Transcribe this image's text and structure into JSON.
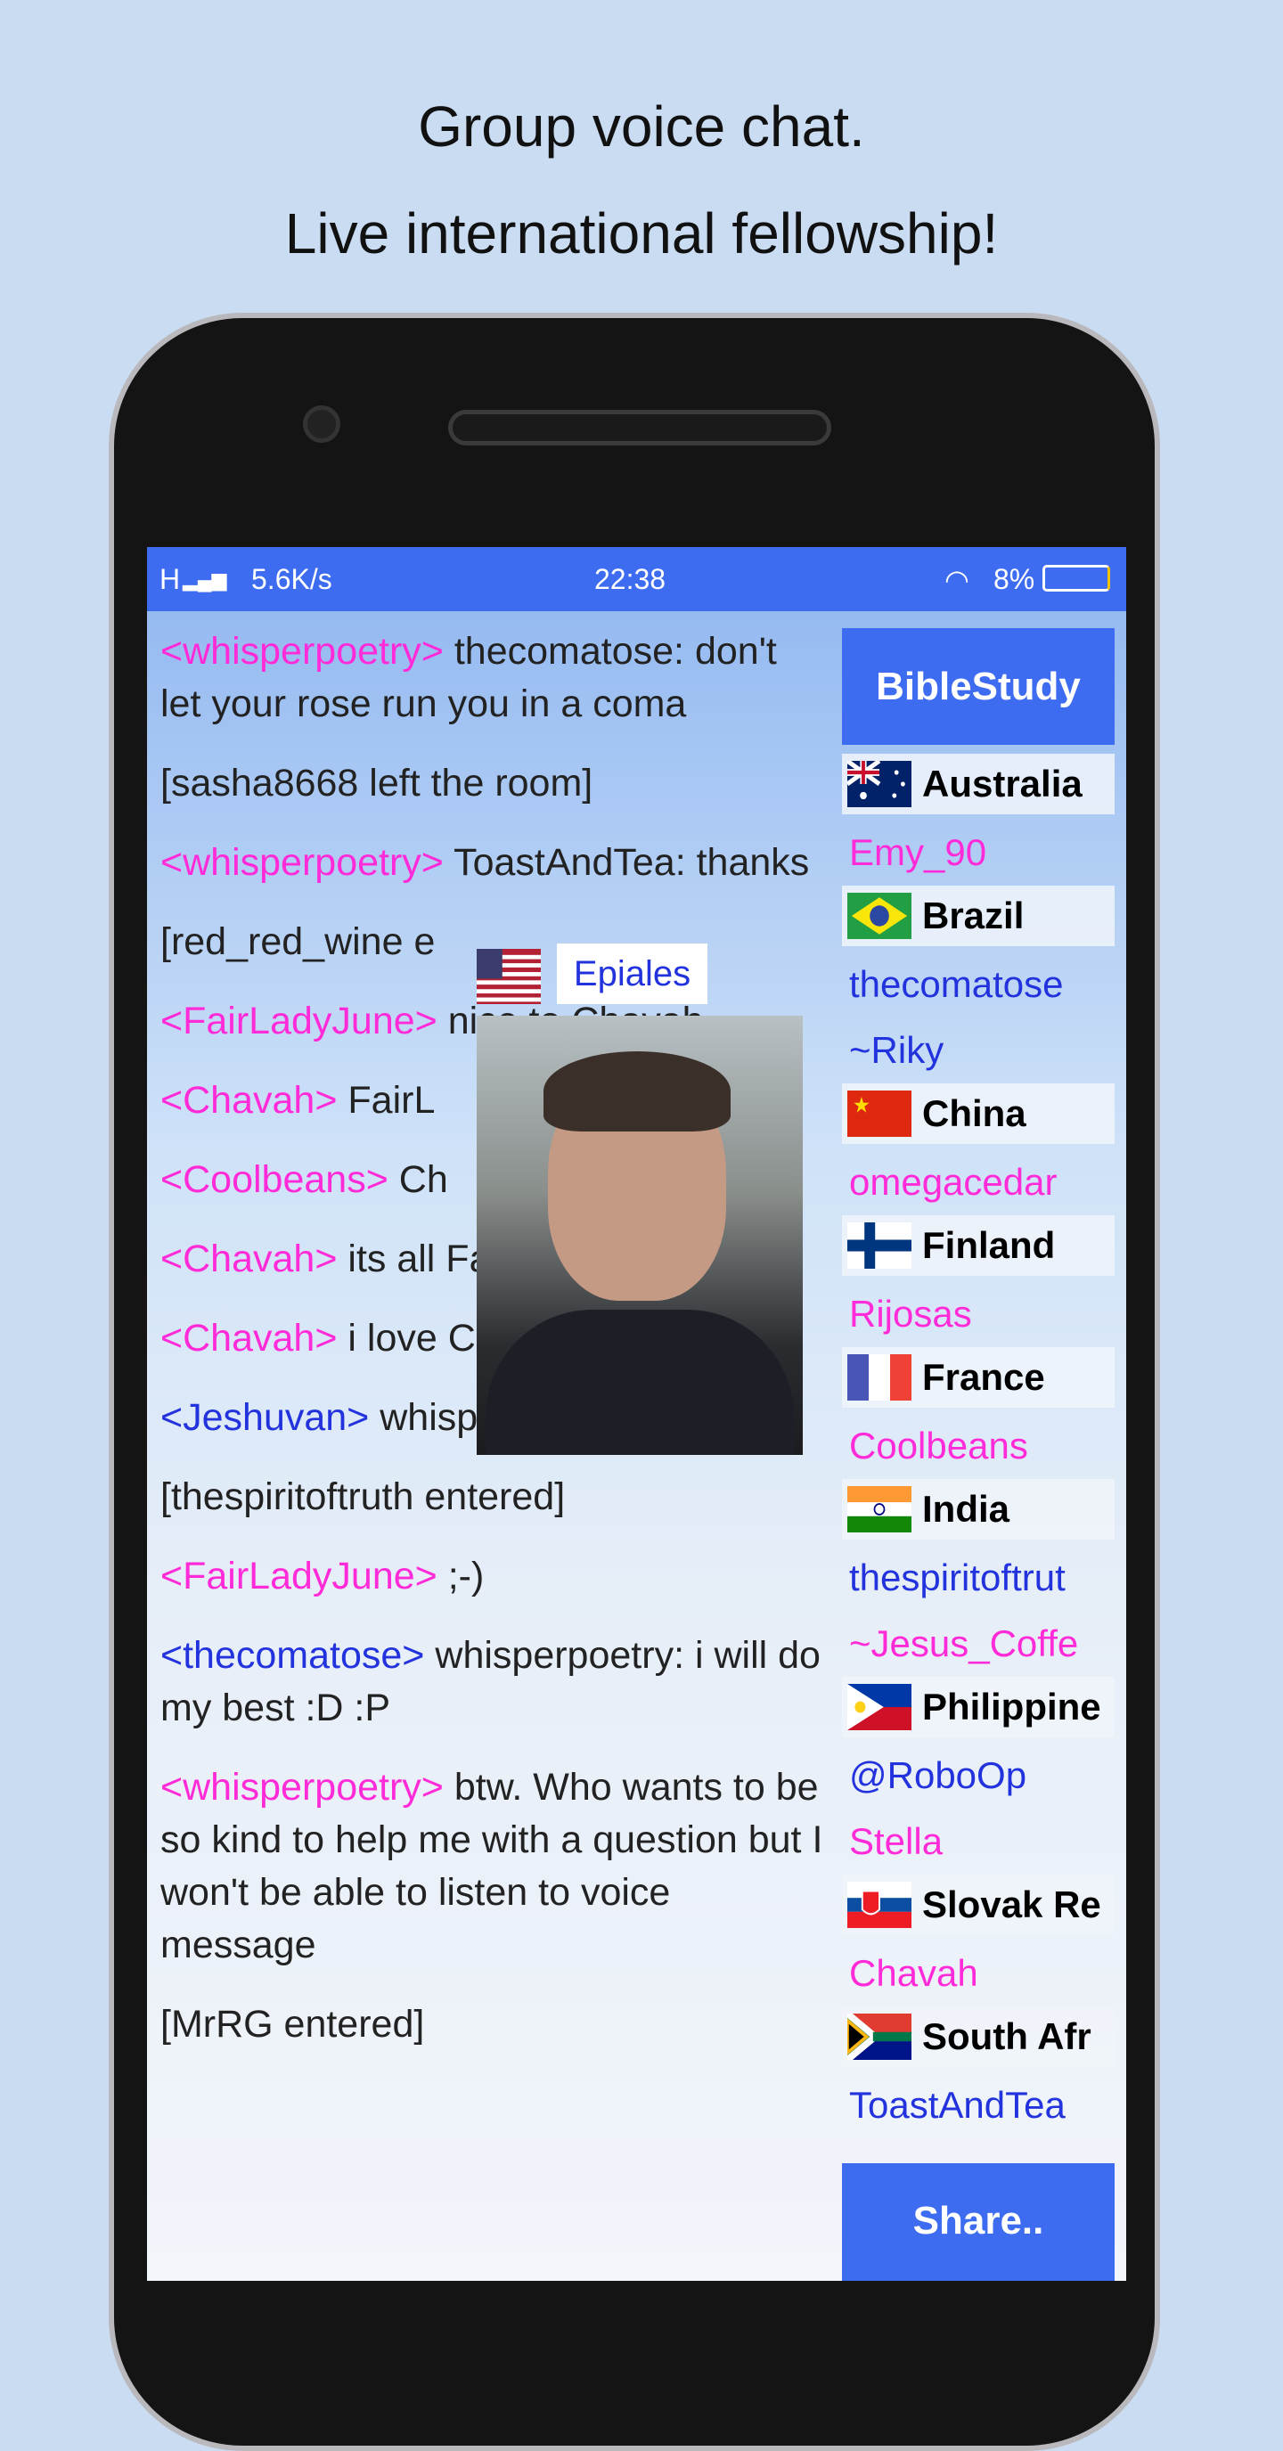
{
  "headline": [
    "Group voice chat.",
    "Live international fellowship!"
  ],
  "status": {
    "network": "H",
    "speed": "5.6K/s",
    "time": "22:38",
    "battery": "8%"
  },
  "chat": [
    {
      "nick": "<whisperpoetry>",
      "color": "pink",
      "text": " thecomatose: don't let your rose run you in a coma"
    },
    {
      "nick": "",
      "text": "[sasha8668 left the room]"
    },
    {
      "nick": "<whisperpoetry>",
      "color": "pink",
      "text": " ToastAndTea: thanks"
    },
    {
      "nick": "",
      "text": "[red_red_wine e"
    },
    {
      "nick": "<FairLadyJune>",
      "color": "pink",
      "text": " nice to Chavah"
    },
    {
      "nick": "<Chavah>",
      "color": "pink",
      "text": " FairL"
    },
    {
      "nick": "<Coolbeans>",
      "color": "pink",
      "text": " Ch"
    },
    {
      "nick": "<Chavah>",
      "color": "pink",
      "text": " its all FairLadyJune"
    },
    {
      "nick": "<Chavah>",
      "color": "pink",
      "text": " i love Coolbeans"
    },
    {
      "nick": "<Jeshuvan>",
      "color": "blue",
      "text": " whisperpoetry: hi"
    },
    {
      "nick": "",
      "text": "[thespiritoftruth entered]"
    },
    {
      "nick": "<FairLadyJune>",
      "color": "pink",
      "text": " ;-)"
    },
    {
      "nick": "<thecomatose>",
      "color": "blue",
      "text": " whisperpoetry: i will do my best :D  :P"
    },
    {
      "nick": "<whisperpoetry>",
      "color": "pink",
      "text": " btw. Who wants to be so kind to help me with a question but I won't be able to listen to voice message"
    },
    {
      "nick": "",
      "text": "[MrRG entered]"
    }
  ],
  "video": {
    "name": "Epiales",
    "flag": "usa-flag-icon"
  },
  "sidebar": {
    "room": "BibleStudy",
    "groups": [
      {
        "country": "Australia",
        "flag": "au",
        "users": [
          {
            "name": "Emy_90",
            "color": "pink"
          }
        ]
      },
      {
        "country": "Brazil",
        "flag": "br",
        "users": [
          {
            "name": "thecomatose",
            "color": "blue"
          },
          {
            "name": "~Riky",
            "color": "blue"
          }
        ]
      },
      {
        "country": "China",
        "flag": "cn",
        "users": [
          {
            "name": "omegacedar",
            "color": "pink"
          }
        ]
      },
      {
        "country": "Finland",
        "flag": "fi",
        "users": [
          {
            "name": "Rijosas",
            "color": "pink"
          }
        ]
      },
      {
        "country": "France",
        "flag": "fr",
        "users": [
          {
            "name": "Coolbeans",
            "color": "pink"
          }
        ]
      },
      {
        "country": "India",
        "flag": "in",
        "users": [
          {
            "name": "thespiritoftrut",
            "color": "blue"
          },
          {
            "name": "~Jesus_Coffe",
            "color": "pink"
          }
        ]
      },
      {
        "country": "Philippine",
        "flag": "ph",
        "users": [
          {
            "name": "@RoboOp",
            "color": "blue"
          },
          {
            "name": "Stella",
            "color": "pink"
          }
        ]
      },
      {
        "country": "Slovak Re",
        "flag": "sk",
        "users": [
          {
            "name": "Chavah",
            "color": "pink"
          }
        ]
      },
      {
        "country": "South Afr",
        "flag": "za",
        "users": [
          {
            "name": "ToastAndTea",
            "color": "blue"
          }
        ]
      }
    ],
    "share": "Share.."
  },
  "colors": {
    "accent": "#3d6cf0",
    "pink": "#ff2bd8",
    "blue": "#2233dd"
  }
}
